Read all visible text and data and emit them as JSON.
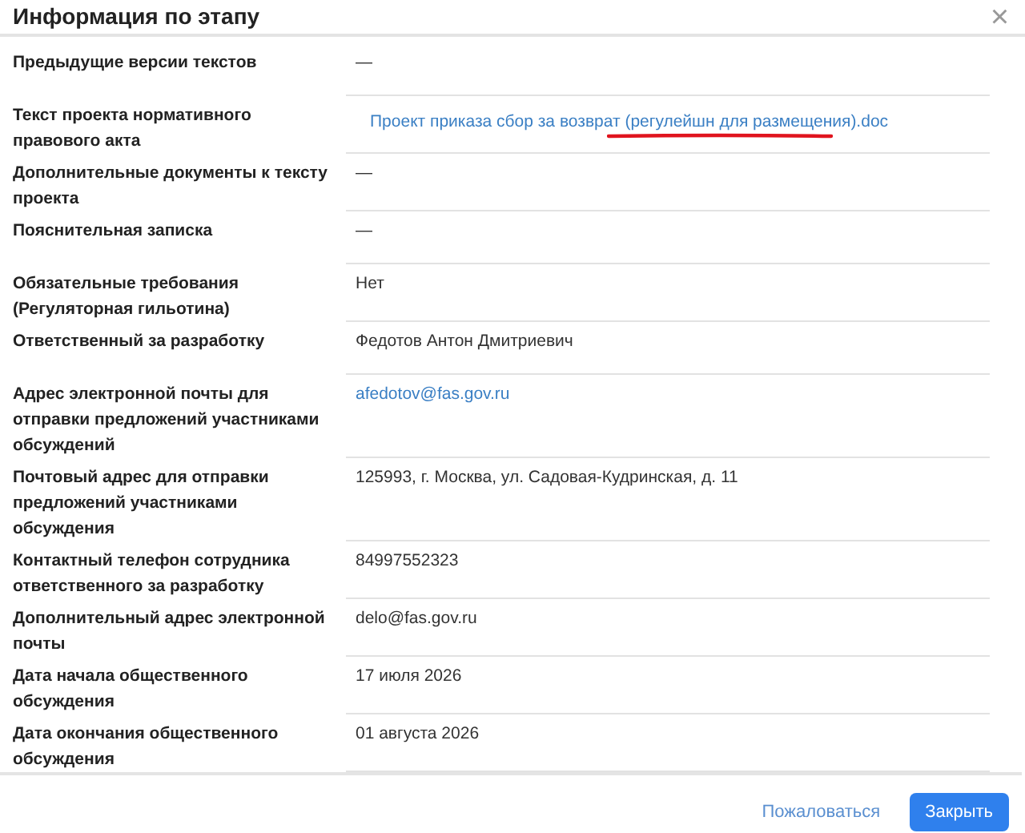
{
  "dialog": {
    "title": "Информация по этапу",
    "close_icon": "×"
  },
  "rows": [
    {
      "label": "Предыдущие версии текстов",
      "value": "—",
      "kind": "text"
    },
    {
      "label": "Текст проекта нормативного правового акта",
      "value": "Проект приказа сбор за возврат (регулейшн для размещения).doc",
      "kind": "link"
    },
    {
      "label": "Дополнительные документы к тексту проекта",
      "value": "—",
      "kind": "text"
    },
    {
      "label": "Пояснительная записка",
      "value": "—",
      "kind": "text"
    },
    {
      "label": "Обязательные требования (Регуляторная гильотина)",
      "value": "Нет",
      "kind": "text"
    },
    {
      "label": "Ответственный за разработку",
      "value": "Федотов Антон Дмитриевич",
      "kind": "text"
    },
    {
      "label": "Адрес электронной почты для отправки предложений участниками обсуждений",
      "value": "afedotov@fas.gov.ru",
      "kind": "email"
    },
    {
      "label": "Почтовый адрес для отправки предложений участниками обсуждения",
      "value": "125993, г. Москва, ул. Садовая-Кудринская, д. 11",
      "kind": "text"
    },
    {
      "label": "Контактный телефон сотрудника ответственного за разработку",
      "value": "84997552323",
      "kind": "text"
    },
    {
      "label": "Дополнительный адрес электронной почты",
      "value": "delo@fas.gov.ru",
      "kind": "text"
    },
    {
      "label": "Дата начала общественного обсуждения",
      "value": "17 июля 2026",
      "kind": "text"
    },
    {
      "label": "Дата окончания общественного обсуждения",
      "value": "01 августа 2026",
      "kind": "text"
    }
  ],
  "footer": {
    "complain": "Пожаловаться",
    "close": "Закрыть"
  }
}
